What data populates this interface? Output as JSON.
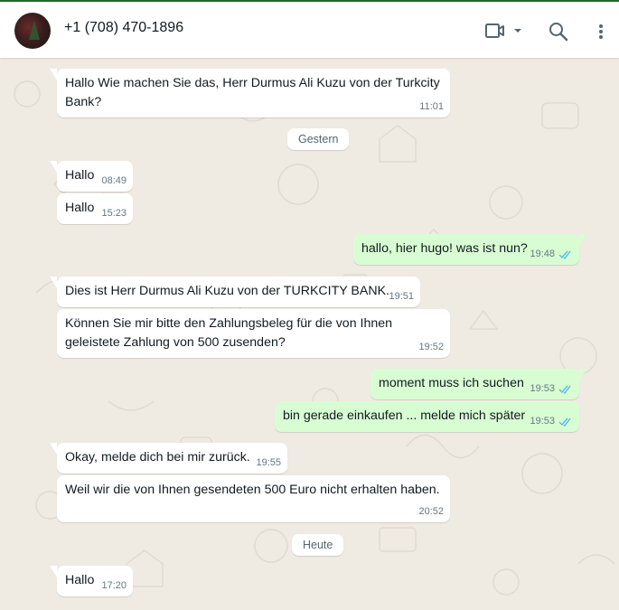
{
  "header": {
    "contact_name": "+1 (708) 470-1896",
    "icons": [
      "video-call-icon",
      "dropdown-caret-icon",
      "search-icon",
      "menu-icon"
    ]
  },
  "chat": {
    "messages": [
      {
        "dir": "in",
        "text": "Hallo Wie machen Sie das, Herr Durmus Ali Kuzu von der Turkcity Bank?",
        "time": "11:01"
      },
      {
        "dir": "in",
        "text": "Hallo",
        "time": "08:49"
      },
      {
        "dir": "in",
        "text": "Hallo",
        "time": "15:23"
      },
      {
        "dir": "out",
        "text": "hallo, hier hugo! was ist nun?",
        "time": "19:48",
        "status": "read"
      },
      {
        "dir": "in",
        "text": "Dies ist Herr Durmus Ali Kuzu von der TURKCITY BANK.",
        "time": "19:51"
      },
      {
        "dir": "in",
        "text": "Können Sie mir bitte den Zahlungsbeleg für die von Ihnen geleistete Zahlung von 500 zusenden?",
        "time": "19:52"
      },
      {
        "dir": "out",
        "text": "moment muss ich suchen",
        "time": "19:53",
        "status": "read"
      },
      {
        "dir": "out",
        "text": "bin gerade einkaufen ... melde mich später",
        "time": "19:53",
        "status": "read"
      },
      {
        "dir": "in",
        "text": "Okay, melde dich bei mir zurück.",
        "time": "19:55"
      },
      {
        "dir": "in",
        "text": "Weil wir die von Ihnen gesendeten 500 Euro nicht erhalten haben.",
        "time": "20:52"
      },
      {
        "dir": "in",
        "text": "Hallo",
        "time": "17:20"
      }
    ],
    "date_separators": [
      "Gestern",
      "Heute"
    ]
  },
  "colors": {
    "incoming_bubble": "#ffffff",
    "outgoing_bubble": "#d9fdd3",
    "chat_background": "#efeae2",
    "read_ticks": "#53bdeb"
  }
}
